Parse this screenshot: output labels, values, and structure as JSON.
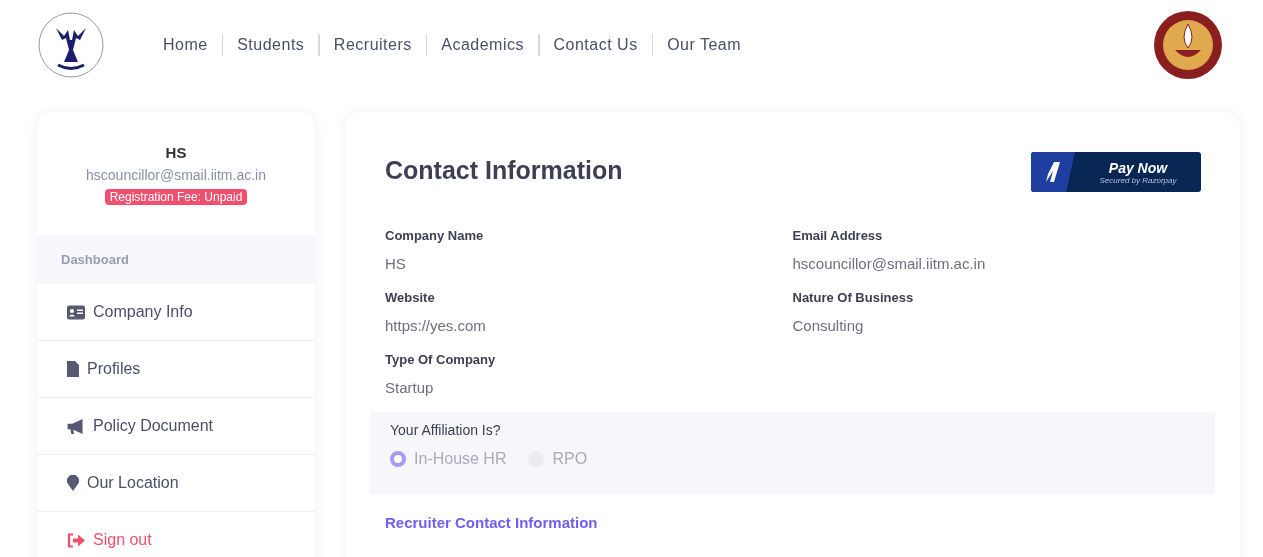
{
  "nav": [
    {
      "label": "Home"
    },
    {
      "label": "Students"
    },
    {
      "label": "Recruiters"
    },
    {
      "label": "Academics"
    },
    {
      "label": "Contact Us"
    },
    {
      "label": "Our Team"
    }
  ],
  "profile": {
    "name": "HS",
    "email": "hscouncillor@smail.iitm.ac.in",
    "badge": "Registration Fee: Unpaid"
  },
  "sidebar": {
    "header": "Dashboard",
    "items": [
      {
        "label": "Company Info",
        "kind": "card"
      },
      {
        "label": "Profiles",
        "kind": "file"
      },
      {
        "label": "Policy Document",
        "kind": "megaphone"
      },
      {
        "label": "Our Location",
        "kind": "pin"
      },
      {
        "label": "Sign out",
        "kind": "signout"
      }
    ]
  },
  "main": {
    "title": "Contact Information",
    "pay_button": {
      "label": "Pay Now",
      "sub": "Secured by Razorpay"
    },
    "fields": [
      {
        "label": "Company Name",
        "value": "HS"
      },
      {
        "label": "Email Address",
        "value": "hscouncillor@smail.iitm.ac.in"
      },
      {
        "label": "Website",
        "value": "https://yes.com"
      },
      {
        "label": "Nature Of Business",
        "value": "Consulting"
      },
      {
        "label": "Type Of Company",
        "value": "Startup"
      }
    ],
    "affiliation": {
      "question": "Your Affiliation Is?",
      "options": [
        {
          "label": "In-House HR",
          "selected": true
        },
        {
          "label": "RPO",
          "selected": false
        }
      ]
    },
    "section_title": "Recruiter Contact Information"
  }
}
